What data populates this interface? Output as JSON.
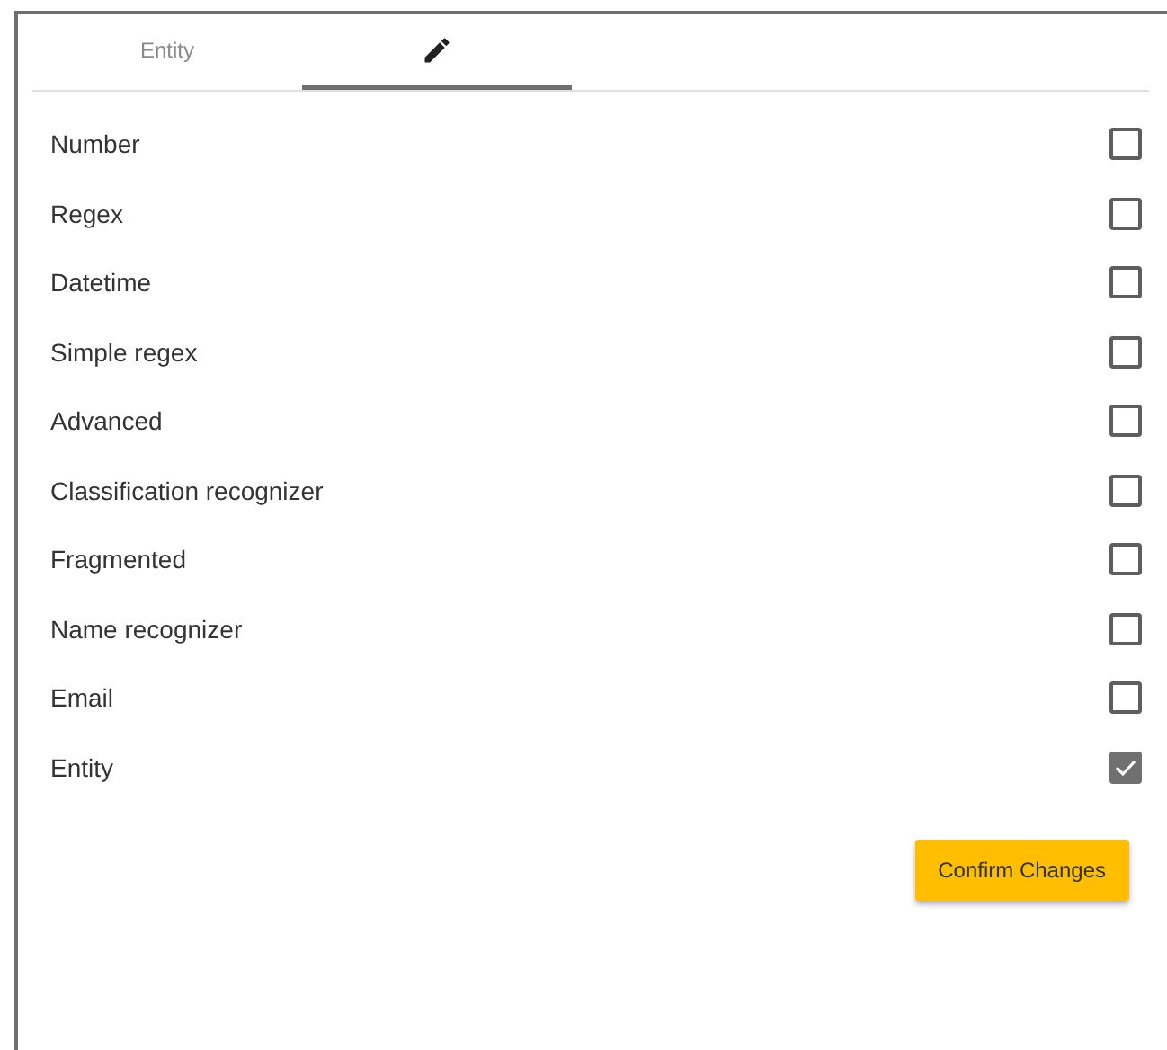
{
  "tabs": [
    {
      "kind": "text",
      "label": "Entity",
      "selected": false
    },
    {
      "kind": "icon",
      "selected": true
    }
  ],
  "options": [
    {
      "label": "Number",
      "checked": false
    },
    {
      "label": "Regex",
      "checked": false
    },
    {
      "label": "Datetime",
      "checked": false
    },
    {
      "label": "Simple regex",
      "checked": false
    },
    {
      "label": "Advanced",
      "checked": false
    },
    {
      "label": "Classification recognizer",
      "checked": false
    },
    {
      "label": "Fragmented",
      "checked": false
    },
    {
      "label": "Name recognizer",
      "checked": false
    },
    {
      "label": "Email",
      "checked": false
    },
    {
      "label": "Entity",
      "checked": true
    }
  ],
  "confirm_button": "Confirm Changes"
}
